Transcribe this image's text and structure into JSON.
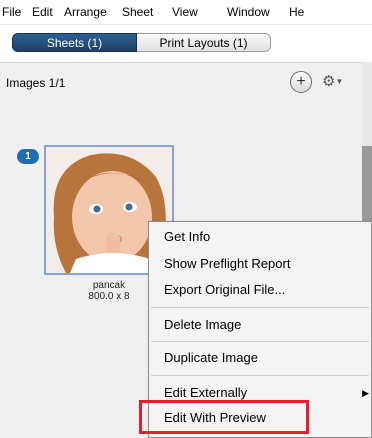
{
  "menubar": {
    "items": [
      "File",
      "Edit",
      "Arrange",
      "Sheet",
      "View",
      "Window",
      "He"
    ]
  },
  "tabs": [
    {
      "label": "Sheets (1)",
      "active": true
    },
    {
      "label": "Print Layouts (1)",
      "active": false
    }
  ],
  "panel": {
    "title": "Images 1/1",
    "add_icon": "plus-circle-icon",
    "gear_icon": "gear-icon"
  },
  "image_item": {
    "badge": "1",
    "name": "pancak",
    "dimensions": "800.0 x 8"
  },
  "context_menu": {
    "items": [
      {
        "label": "Get Info"
      },
      {
        "label": "Show Preflight Report"
      },
      {
        "label": "Export Original File..."
      },
      {
        "label": "Delete Image"
      },
      {
        "label": "Duplicate Image"
      },
      {
        "label": "Edit Externally",
        "submenu": true
      },
      {
        "label": "Edit With Preview",
        "highlighted": true
      }
    ]
  },
  "colors": {
    "active_tab": "#1f4a78",
    "badge": "#1f6fb5",
    "highlight": "#e0202a",
    "selection_border": "#8aa3dc"
  }
}
